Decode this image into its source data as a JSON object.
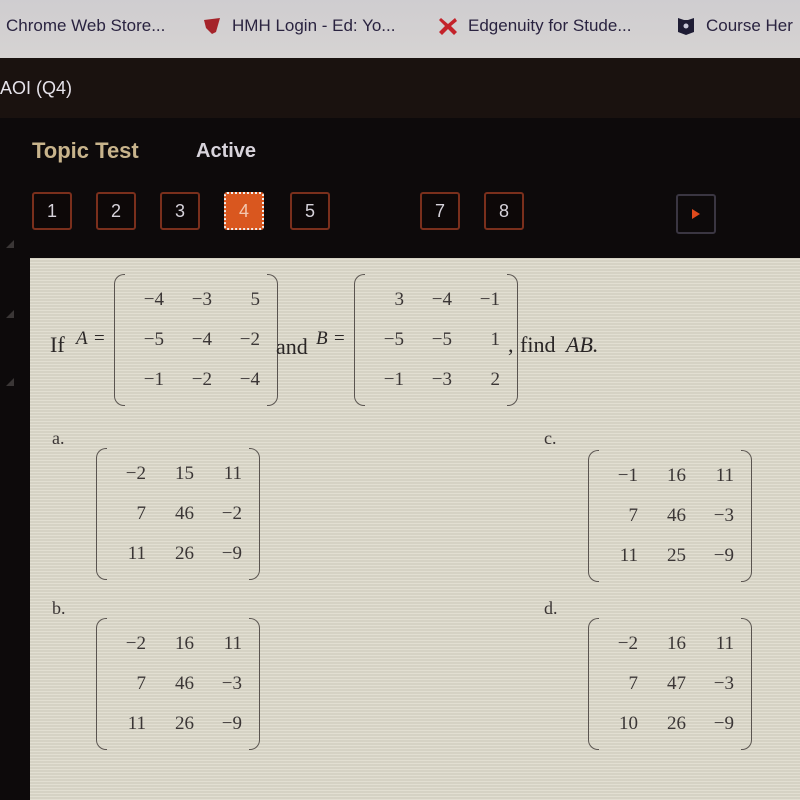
{
  "bookmarks": [
    {
      "label": "Chrome Web Store...",
      "icon": "chrome-web-store-icon"
    },
    {
      "label": "HMH Login - Ed: Yo...",
      "icon": "hmh-shield-icon",
      "icon_color": "#b1262a"
    },
    {
      "label": "Edgenuity for Stude...",
      "icon": "edgenuity-x-icon",
      "icon_color": "#c4222a"
    },
    {
      "label": "Course Her",
      "icon": "course-hero-shield-icon",
      "icon_color": "#1e1c34"
    }
  ],
  "course": {
    "title": "AOI (Q4)"
  },
  "test": {
    "title": "Topic Test",
    "status": "Active"
  },
  "question_nav": {
    "items": [
      {
        "label": "1",
        "active": false
      },
      {
        "label": "2",
        "active": false
      },
      {
        "label": "3",
        "active": false
      },
      {
        "label": "4",
        "active": true
      },
      {
        "label": "5",
        "active": false
      },
      {
        "label": "7",
        "active": false
      },
      {
        "label": "8",
        "active": false
      }
    ],
    "next_icon": "play-arrow-icon",
    "accent_color": "#d9571f"
  },
  "question": {
    "prefix": "If",
    "var_a": "A",
    "equals": "=",
    "conjunction": "and",
    "var_b": "B",
    "suffix_comma": ",",
    "suffix_find": "find",
    "target": "AB.",
    "matrix_a": [
      [
        "−4",
        "−3",
        "5"
      ],
      [
        "−5",
        "−4",
        "−2"
      ],
      [
        "−1",
        "−2",
        "−4"
      ]
    ],
    "matrix_b": [
      [
        "3",
        "−4",
        "−1"
      ],
      [
        "−5",
        "−5",
        "1"
      ],
      [
        "−1",
        "−3",
        "2"
      ]
    ]
  },
  "options": [
    {
      "label": "a.",
      "matrix": [
        [
          "−2",
          "15",
          "11"
        ],
        [
          "7",
          "46",
          "−2"
        ],
        [
          "11",
          "26",
          "−9"
        ]
      ]
    },
    {
      "label": "b.",
      "matrix": [
        [
          "−2",
          "16",
          "11"
        ],
        [
          "7",
          "46",
          "−3"
        ],
        [
          "11",
          "26",
          "−9"
        ]
      ]
    },
    {
      "label": "c.",
      "matrix": [
        [
          "−1",
          "16",
          "11"
        ],
        [
          "7",
          "46",
          "−3"
        ],
        [
          "11",
          "25",
          "−9"
        ]
      ]
    },
    {
      "label": "d.",
      "matrix": [
        [
          "−2",
          "16",
          "11"
        ],
        [
          "7",
          "47",
          "−3"
        ],
        [
          "10",
          "26",
          "−9"
        ]
      ]
    }
  ]
}
